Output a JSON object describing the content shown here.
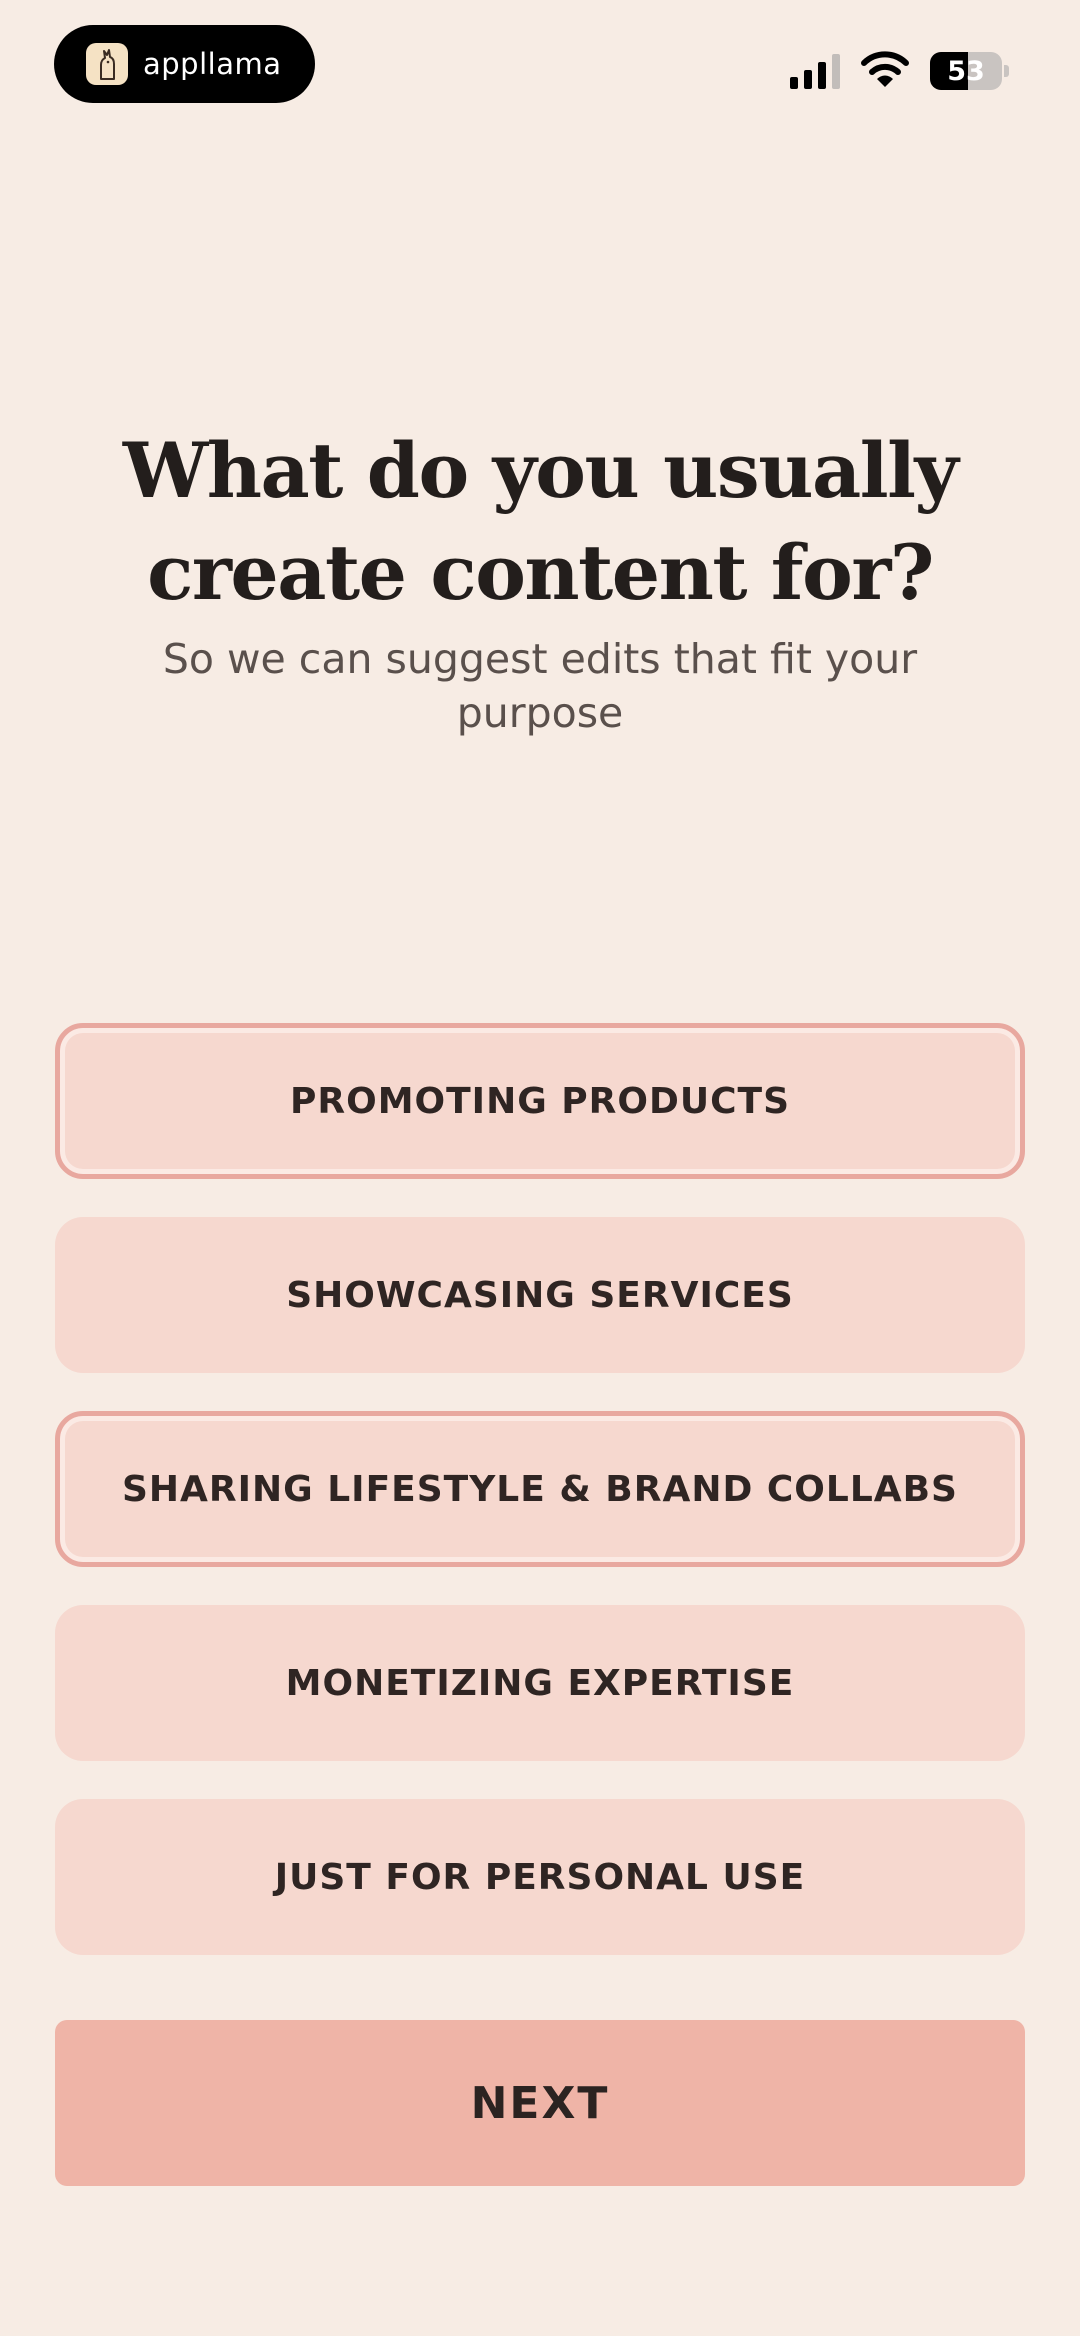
{
  "status_bar": {
    "brand_name": "appllama",
    "battery_level": "53",
    "battery_fraction": 0.53,
    "icons": [
      "llama-logo-icon",
      "signal-icon",
      "wifi-icon",
      "battery-icon"
    ]
  },
  "header": {
    "title": "What do you usually create content for?",
    "subtitle": "So we can suggest edits that fit your purpose"
  },
  "options": [
    {
      "label": "PROMOTING PRODUCTS",
      "selected": true
    },
    {
      "label": "SHOWCASING SERVICES",
      "selected": false
    },
    {
      "label": "SHARING LIFESTYLE & BRAND COLLABS",
      "selected": true
    },
    {
      "label": "MONETIZING EXPERTISE",
      "selected": false
    },
    {
      "label": "JUST FOR PERSONAL USE",
      "selected": false
    }
  ],
  "footer": {
    "next_label": "NEXT"
  },
  "colors": {
    "background": "#f7ece4",
    "option_fill": "#f6d8cf",
    "option_selected_border": "#e8a89f",
    "next_button": "#efb4a7"
  }
}
